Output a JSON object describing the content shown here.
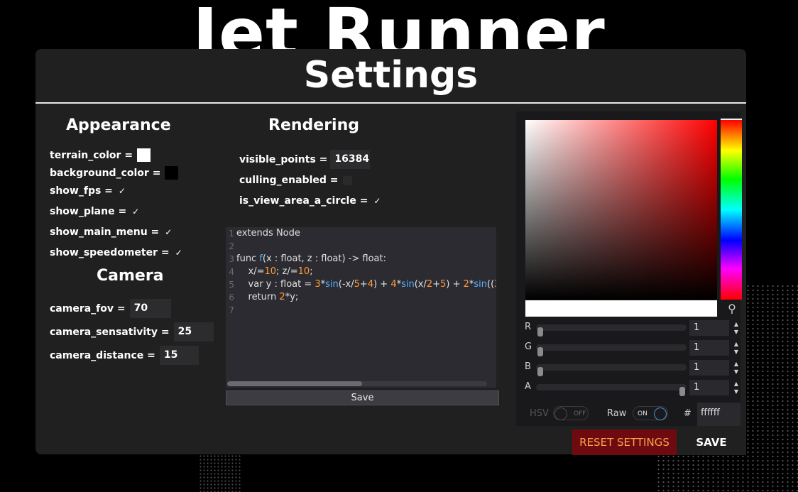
{
  "background_title": "Jet Runner",
  "panel_title": "Settings",
  "appearance": {
    "heading": "Appearance",
    "terrain_color_label": "terrain_color =",
    "terrain_color": "#ffffff",
    "background_color_label": "background_color =",
    "background_color": "#000000",
    "show_fps_label": "show_fps =",
    "show_fps": true,
    "show_plane_label": "show_plane =",
    "show_plane": true,
    "show_main_menu_label": "show_main_menu =",
    "show_main_menu": true,
    "show_speedometer_label": "show_speedometer =",
    "show_speedometer": true
  },
  "camera": {
    "heading": "Camera",
    "fov_label": "camera_fov =",
    "fov_value": "70",
    "sensativity_label": "camera_sensativity =",
    "sensativity_value": "25",
    "distance_label": "camera_distance =",
    "distance_value": "15"
  },
  "rendering": {
    "heading": "Rendering",
    "visible_points_label": "visible_points =",
    "visible_points_value": "16384",
    "culling_label": "culling_enabled =",
    "culling_enabled": false,
    "circle_label": "is_view_area_a_circle =",
    "is_view_area_a_circle": true
  },
  "editor": {
    "line_numbers": [
      "1",
      "2",
      "3",
      "4",
      "5",
      "6",
      "7"
    ],
    "save_label": "Save"
  },
  "color_picker": {
    "channels": [
      {
        "label": "R",
        "value": "1"
      },
      {
        "label": "G",
        "value": "1"
      },
      {
        "label": "B",
        "value": "1"
      },
      {
        "label": "A",
        "value": "1"
      }
    ],
    "hsv_label": "HSV",
    "hsv_state": "OFF",
    "raw_label": "Raw",
    "raw_state": "ON",
    "hash_label": "#",
    "hex_value": "ffffff"
  },
  "footer": {
    "reset_label": "RESET SETTINGS",
    "save_label": "SAVE"
  },
  "check_glyph": "✓"
}
